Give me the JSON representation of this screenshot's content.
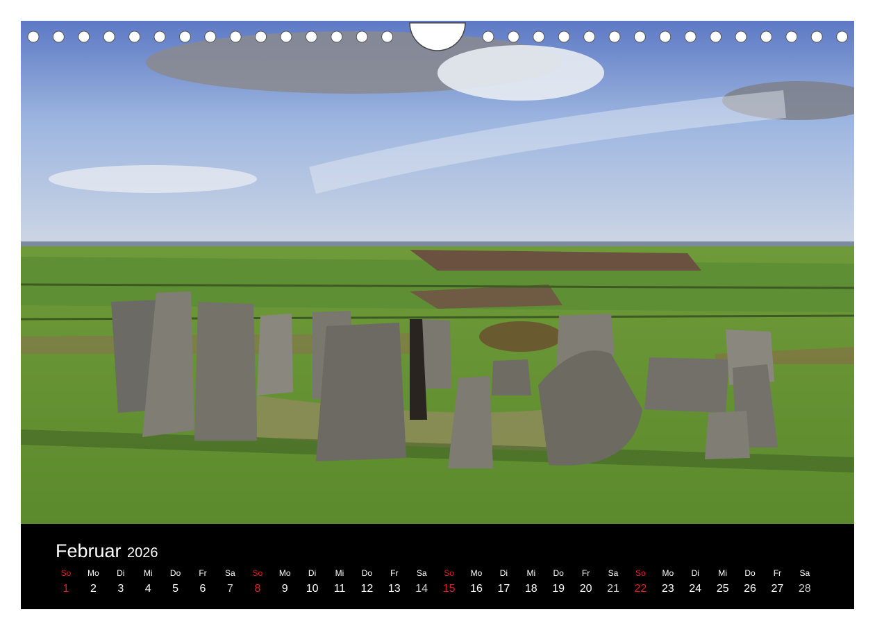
{
  "calendar": {
    "month": "Februar",
    "year": "2026",
    "days": [
      {
        "wd": "So",
        "d": "1",
        "kind": "sun"
      },
      {
        "wd": "Mo",
        "d": "2",
        "kind": "week"
      },
      {
        "wd": "Di",
        "d": "3",
        "kind": "week"
      },
      {
        "wd": "Mi",
        "d": "4",
        "kind": "week"
      },
      {
        "wd": "Do",
        "d": "5",
        "kind": "week"
      },
      {
        "wd": "Fr",
        "d": "6",
        "kind": "week"
      },
      {
        "wd": "Sa",
        "d": "7",
        "kind": "sat"
      },
      {
        "wd": "So",
        "d": "8",
        "kind": "sun"
      },
      {
        "wd": "Mo",
        "d": "9",
        "kind": "week"
      },
      {
        "wd": "Di",
        "d": "10",
        "kind": "week"
      },
      {
        "wd": "Mi",
        "d": "11",
        "kind": "week"
      },
      {
        "wd": "Do",
        "d": "12",
        "kind": "week"
      },
      {
        "wd": "Fr",
        "d": "13",
        "kind": "week"
      },
      {
        "wd": "Sa",
        "d": "14",
        "kind": "sat"
      },
      {
        "wd": "So",
        "d": "15",
        "kind": "sun"
      },
      {
        "wd": "Mo",
        "d": "16",
        "kind": "week"
      },
      {
        "wd": "Di",
        "d": "17",
        "kind": "week"
      },
      {
        "wd": "Mi",
        "d": "18",
        "kind": "week"
      },
      {
        "wd": "Do",
        "d": "19",
        "kind": "week"
      },
      {
        "wd": "Fr",
        "d": "20",
        "kind": "week"
      },
      {
        "wd": "Sa",
        "d": "21",
        "kind": "sat"
      },
      {
        "wd": "So",
        "d": "22",
        "kind": "sun"
      },
      {
        "wd": "Mo",
        "d": "23",
        "kind": "week"
      },
      {
        "wd": "Di",
        "d": "24",
        "kind": "week"
      },
      {
        "wd": "Mi",
        "d": "25",
        "kind": "week"
      },
      {
        "wd": "Do",
        "d": "26",
        "kind": "week"
      },
      {
        "wd": "Fr",
        "d": "27",
        "kind": "week"
      },
      {
        "wd": "Sa",
        "d": "28",
        "kind": "sat"
      }
    ]
  },
  "colors": {
    "sunday": "#e01b24",
    "background": "#000000",
    "text": "#ffffff"
  }
}
